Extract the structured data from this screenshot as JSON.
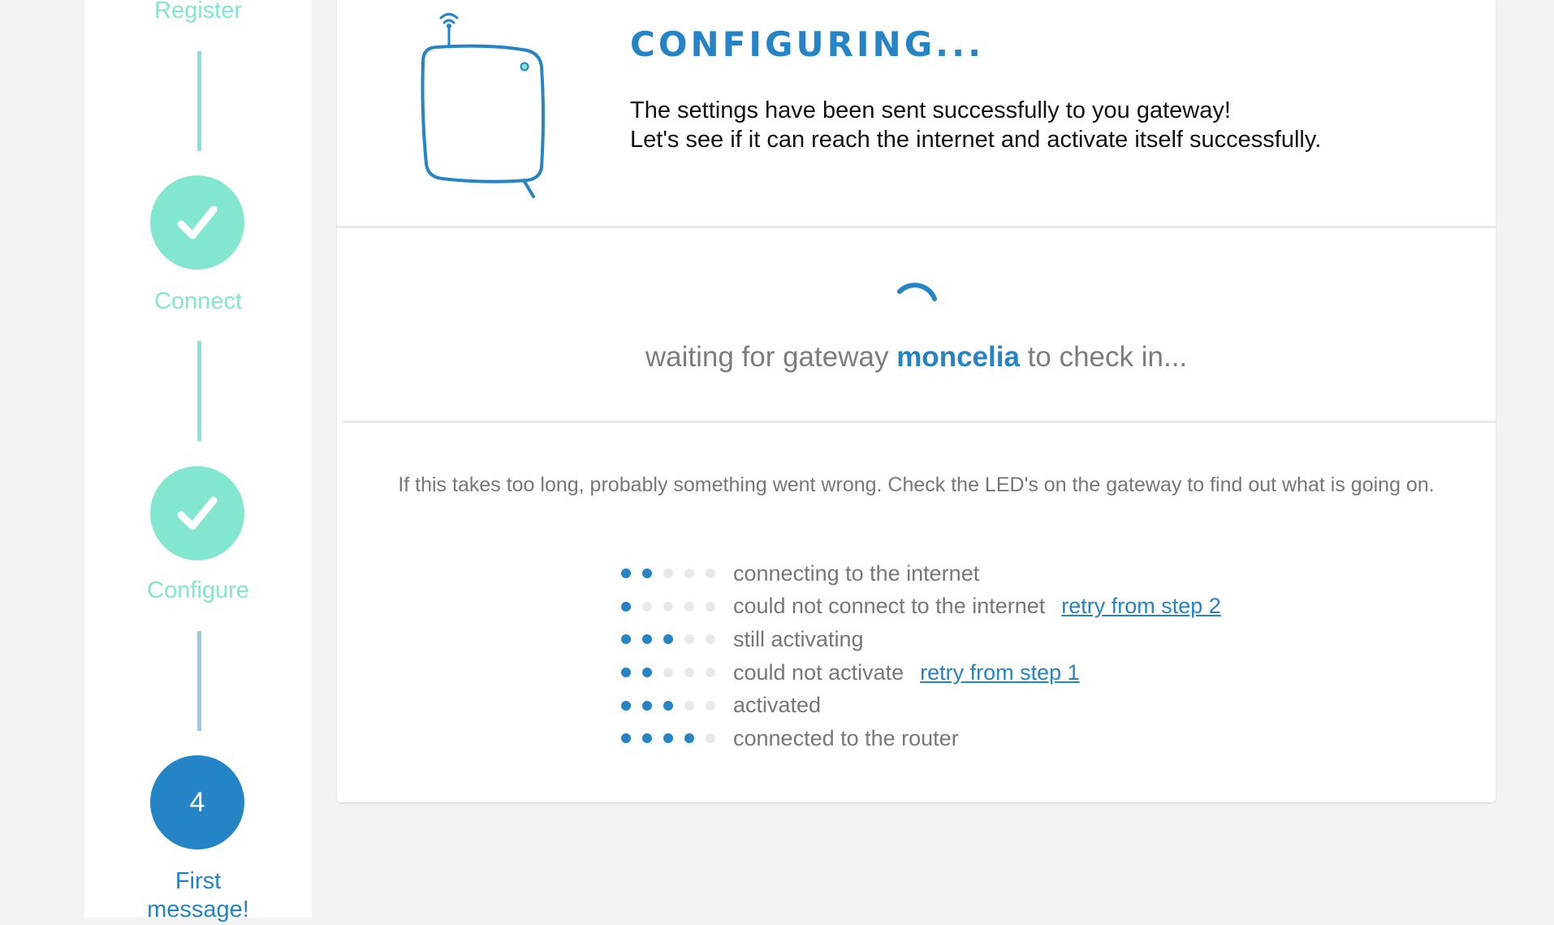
{
  "sidebar": {
    "steps": [
      {
        "label": "Register",
        "state": "done"
      },
      {
        "label": "Connect",
        "state": "done"
      },
      {
        "label": "Configure",
        "state": "done"
      },
      {
        "number": "4",
        "label": "First message!",
        "state": "current"
      }
    ]
  },
  "header": {
    "title": "CONFIGURING...",
    "line1": "The settings have been sent successfully to you gateway!",
    "line2": "Let's see if it can reach the internet and activate itself successfully."
  },
  "status": {
    "prefix": "waiting for gateway",
    "gateway_name": "moncelia",
    "suffix": "to check in..."
  },
  "help": {
    "text": "If this takes too long, probably something went wrong. Check the LED's on the gateway to find out what is going on."
  },
  "led_legend": [
    {
      "leds_on": 2,
      "text": "connecting to the internet",
      "link": ""
    },
    {
      "leds_on": 1,
      "text": "could not connect to the internet",
      "link": "retry from step 2"
    },
    {
      "leds_on": 3,
      "text": "still activating",
      "link": ""
    },
    {
      "leds_on": 2,
      "text": "could not activate",
      "link": "retry from step 1"
    },
    {
      "leds_on": 3,
      "text": "activated",
      "link": ""
    },
    {
      "leds_on": 4,
      "text": "connected to the router",
      "link": ""
    }
  ],
  "led_total": 5,
  "colors": {
    "accent_blue": "#2484c6",
    "done_teal": "#82e6d0",
    "led_off": "#e8e8e8"
  }
}
